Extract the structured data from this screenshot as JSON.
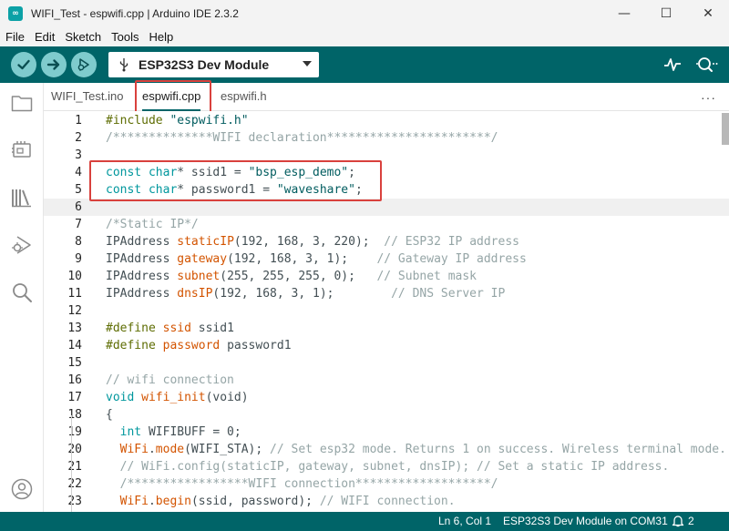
{
  "window": {
    "title": "WIFI_Test - espwifi.cpp | Arduino IDE 2.3.2",
    "logo_text": "∞",
    "minimize": "—",
    "maximize": "☐",
    "close": "✕"
  },
  "menu": [
    "File",
    "Edit",
    "Sketch",
    "Tools",
    "Help"
  ],
  "toolbar": {
    "verify_icon": "check-icon",
    "upload_icon": "arrow-right-icon",
    "debug_icon": "debugger-icon",
    "board_name": "ESP32S3 Dev Module"
  },
  "tabs": [
    {
      "label": "WIFI_Test.ino",
      "active": false
    },
    {
      "label": "espwifi.cpp",
      "active": true
    },
    {
      "label": "espwifi.h",
      "active": false
    }
  ],
  "tab_more": "···",
  "code_lines": [
    {
      "n": "1",
      "tokens": [
        {
          "t": "#include ",
          "c": "pp"
        },
        {
          "t": "\"espwifi.h\"",
          "c": "str"
        }
      ]
    },
    {
      "n": "2",
      "tokens": [
        {
          "t": "/**************WIFI declaration***********************/",
          "c": "com"
        }
      ]
    },
    {
      "n": "3",
      "tokens": []
    },
    {
      "n": "4",
      "tokens": [
        {
          "t": "const ",
          "c": "kw"
        },
        {
          "t": "char",
          "c": "kw"
        },
        {
          "t": "* ssid1 = ",
          "c": "plain"
        },
        {
          "t": "\"bsp_esp_demo\"",
          "c": "str"
        },
        {
          "t": ";",
          "c": "plain"
        }
      ]
    },
    {
      "n": "5",
      "tokens": [
        {
          "t": "const ",
          "c": "kw"
        },
        {
          "t": "char",
          "c": "kw"
        },
        {
          "t": "* password1 = ",
          "c": "plain"
        },
        {
          "t": "\"waveshare\"",
          "c": "str"
        },
        {
          "t": ";",
          "c": "plain"
        }
      ]
    },
    {
      "n": "6",
      "tokens": [],
      "current": true
    },
    {
      "n": "7",
      "tokens": [
        {
          "t": "/*Static IP*/",
          "c": "com"
        }
      ]
    },
    {
      "n": "8",
      "tokens": [
        {
          "t": "IPAddress ",
          "c": "plain"
        },
        {
          "t": "staticIP",
          "c": "fn"
        },
        {
          "t": "(192, 168, 3, 220);  ",
          "c": "plain"
        },
        {
          "t": "// ESP32 IP address",
          "c": "com"
        }
      ]
    },
    {
      "n": "9",
      "tokens": [
        {
          "t": "IPAddress ",
          "c": "plain"
        },
        {
          "t": "gateway",
          "c": "fn"
        },
        {
          "t": "(192, 168, 3, 1);    ",
          "c": "plain"
        },
        {
          "t": "// Gateway IP address",
          "c": "com"
        }
      ]
    },
    {
      "n": "10",
      "tokens": [
        {
          "t": "IPAddress ",
          "c": "plain"
        },
        {
          "t": "subnet",
          "c": "fn"
        },
        {
          "t": "(255, 255, 255, 0);   ",
          "c": "plain"
        },
        {
          "t": "// Subnet mask",
          "c": "com"
        }
      ]
    },
    {
      "n": "11",
      "tokens": [
        {
          "t": "IPAddress ",
          "c": "plain"
        },
        {
          "t": "dnsIP",
          "c": "fn"
        },
        {
          "t": "(192, 168, 3, 1);        ",
          "c": "plain"
        },
        {
          "t": "// DNS Server IP",
          "c": "com"
        }
      ]
    },
    {
      "n": "12",
      "tokens": []
    },
    {
      "n": "13",
      "tokens": [
        {
          "t": "#define ",
          "c": "pp"
        },
        {
          "t": "ssid",
          "c": "fn"
        },
        {
          "t": " ssid1",
          "c": "plain"
        }
      ]
    },
    {
      "n": "14",
      "tokens": [
        {
          "t": "#define ",
          "c": "pp"
        },
        {
          "t": "password",
          "c": "fn"
        },
        {
          "t": " password1",
          "c": "plain"
        }
      ]
    },
    {
      "n": "15",
      "tokens": []
    },
    {
      "n": "16",
      "tokens": [
        {
          "t": "// wifi connection",
          "c": "com"
        }
      ]
    },
    {
      "n": "17",
      "tokens": [
        {
          "t": "void ",
          "c": "kw"
        },
        {
          "t": "wifi_init",
          "c": "fn"
        },
        {
          "t": "(void)",
          "c": "plain"
        }
      ]
    },
    {
      "n": "18",
      "tokens": [
        {
          "t": "{",
          "c": "plain"
        }
      ]
    },
    {
      "n": "19",
      "tokens": [
        {
          "t": "  int ",
          "c": "kw"
        },
        {
          "t": "WIFIBUFF = 0;",
          "c": "plain"
        }
      ]
    },
    {
      "n": "20",
      "tokens": [
        {
          "t": "  WiFi",
          "c": "fn"
        },
        {
          "t": ".",
          "c": "plain"
        },
        {
          "t": "mode",
          "c": "fn"
        },
        {
          "t": "(WIFI_STA); ",
          "c": "plain"
        },
        {
          "t": "// Set esp32 mode. Returns 1 on success. Wireless terminal mode.",
          "c": "com"
        }
      ]
    },
    {
      "n": "21",
      "tokens": [
        {
          "t": "  // WiFi.config(staticIP, gateway, subnet, dnsIP); // Set a static IP address.",
          "c": "com"
        }
      ]
    },
    {
      "n": "22",
      "tokens": [
        {
          "t": "  /*****************WIFI connection*******************/",
          "c": "com"
        }
      ]
    },
    {
      "n": "23",
      "tokens": [
        {
          "t": "  WiFi",
          "c": "fn"
        },
        {
          "t": ".",
          "c": "plain"
        },
        {
          "t": "begin",
          "c": "fn"
        },
        {
          "t": "(ssid, password); ",
          "c": "plain"
        },
        {
          "t": "// WIFI connection.",
          "c": "com"
        }
      ]
    }
  ],
  "status": {
    "position": "Ln 6, Col 1",
    "board": "ESP32S3 Dev Module on COM31",
    "notifications": "2"
  },
  "colors": {
    "teal": "#006468",
    "highlight_red": "#d9413d"
  }
}
